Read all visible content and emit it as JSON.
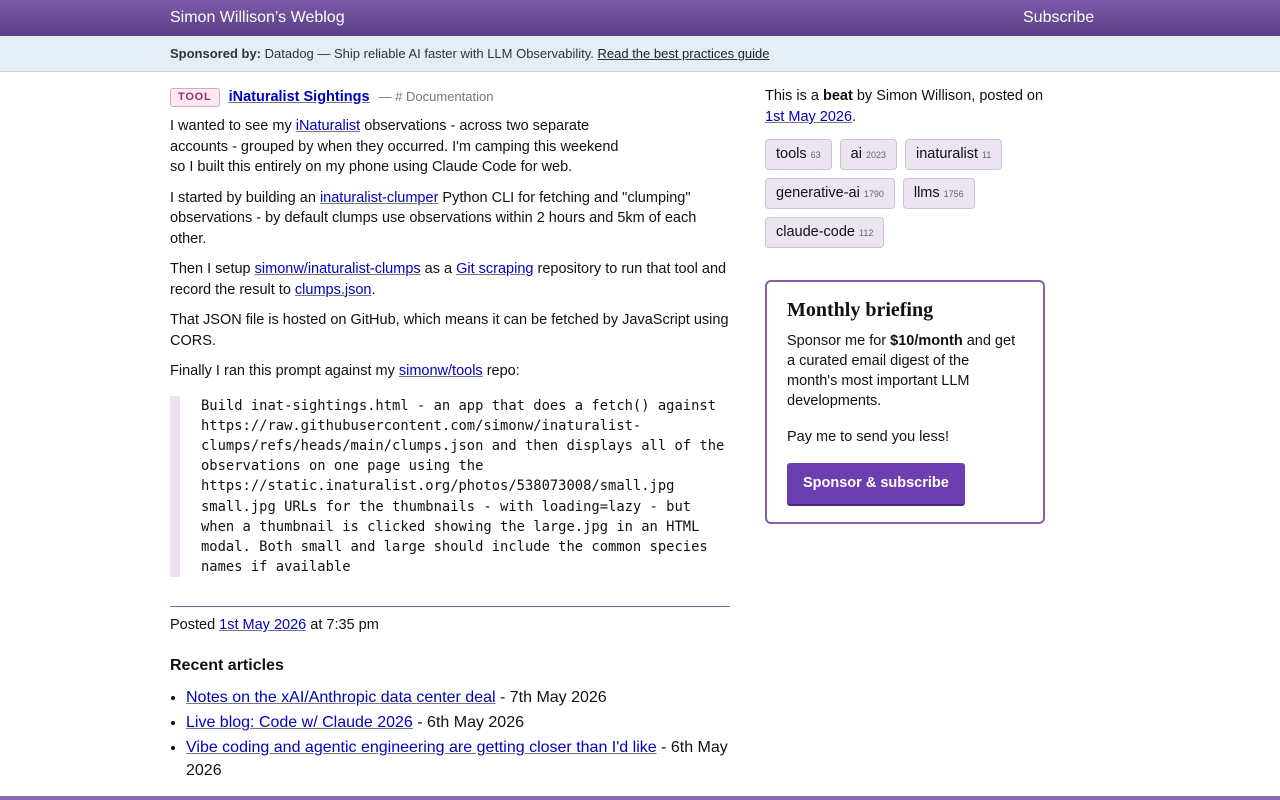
{
  "header": {
    "site_title": "Simon Willison’s Weblog",
    "subscribe": "Subscribe"
  },
  "sponsor": {
    "label": "Sponsored by:",
    "text": " Datadog — Ship reliable AI faster with LLM Observability. ",
    "link": "Read the best practices guide"
  },
  "entry": {
    "badge": "TOOL",
    "title": "iNaturalist Sightings",
    "meta": "— # Documentation",
    "p1": [
      "I wanted to see my ",
      "iNaturalist",
      " observations - across two separate accounts - grouped by when they occurred. I'm camping this weekend so I built this entirely on my phone using Claude Code for web."
    ],
    "p2": [
      "I started by building an ",
      "inaturalist-clumper",
      " Python CLI for fetching and \"clumping\" observations - by default clumps use observations within 2 hours and 5km of each other."
    ],
    "p3": [
      "Then I setup ",
      "simonw/inaturalist-clumps",
      " as a ",
      "Git scraping",
      " repository to run that tool and record the result to ",
      "clumps.json",
      "."
    ],
    "p4": "That JSON file is hosted on GitHub, which means it can be fetched by JavaScript using CORS.",
    "p5": [
      "Finally I ran this prompt against my ",
      "simonw/tools",
      " repo:"
    ],
    "prompt": "Build inat-sightings.html - an app that does a fetch() against https://raw.githubusercontent.com/simonw/inaturalist-clumps/refs/heads/main/clumps.json and then displays all of the observations on one page using the https://static.inaturalist.org/photos/538073008/small.jpg small.jpg URLs for the thumbnails - with loading=lazy - but when a thumbnail is clicked showing the large.jpg in an HTML modal. Both small and large should include the common species names if available",
    "posted_prefix": "Posted ",
    "posted_date": "1st May 2026",
    "posted_time": " at 7:35 pm"
  },
  "recent": {
    "heading": "Recent articles",
    "items": [
      {
        "title": "Notes on the xAI/Anthropic data center deal",
        "date": " - 7th May 2026"
      },
      {
        "title": "Live blog: Code w/ Claude 2026",
        "date": " - 6th May 2026"
      },
      {
        "title": "Vibe coding and agentic engineering are getting closer than I'd like",
        "date": " - 6th May 2026"
      }
    ]
  },
  "sidebar": {
    "beat_pre": "This is a ",
    "beat_word": "beat",
    "beat_post": " by Simon Willison, posted on ",
    "beat_date": "1st May 2026",
    "beat_end": ".",
    "tags": [
      {
        "name": "tools",
        "count": "63"
      },
      {
        "name": "ai",
        "count": "2023"
      },
      {
        "name": "inaturalist",
        "count": "11"
      },
      {
        "name": "generative-ai",
        "count": "1790"
      },
      {
        "name": "llms",
        "count": "1756"
      },
      {
        "name": "claude-code",
        "count": "112"
      }
    ],
    "briefing": {
      "title": "Monthly briefing",
      "text_pre": "Sponsor me for ",
      "text_price": "$10/month",
      "text_post": " and get a curated email digest of the month's most important LLM developments.",
      "text2": "Pay me to send you less!",
      "button": "Sponsor & subscribe"
    }
  },
  "colors": {
    "header": "#5b3e86",
    "accent": "#8a5da9",
    "button": "#6b3fb0",
    "link": "#0000c0"
  }
}
